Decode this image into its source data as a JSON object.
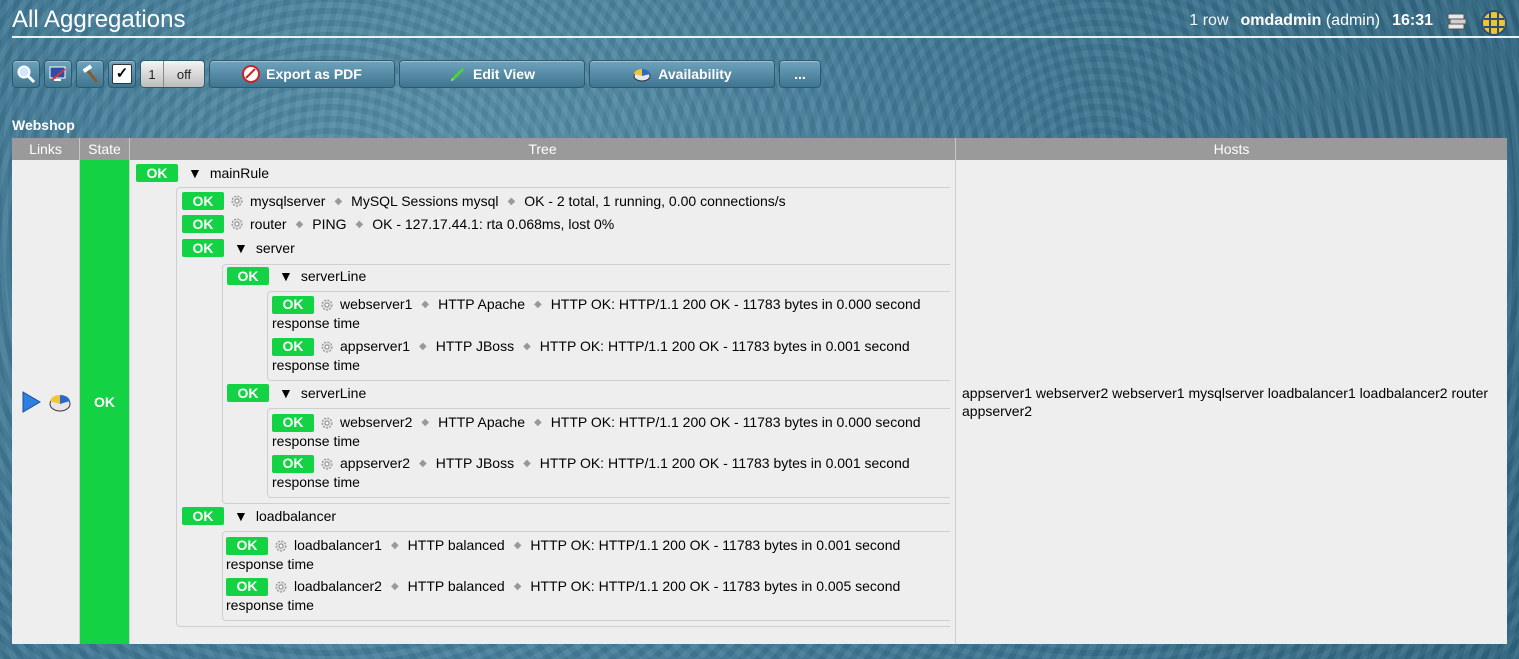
{
  "header": {
    "title": "All Aggregations",
    "rows": "1 row",
    "user": "omdadmin",
    "role": "(admin)",
    "time": "16:31",
    "icons": [
      "books-icon",
      "omd-logo-icon"
    ]
  },
  "toolbar": {
    "count": "1",
    "off": "off",
    "export_pdf": "Export as PDF",
    "edit_view": "Edit View",
    "availability": "Availability",
    "more": "..."
  },
  "section": {
    "title": "Webshop"
  },
  "table": {
    "headers": {
      "links": "Links",
      "state": "State",
      "tree": "Tree",
      "hosts": "Hosts"
    },
    "state": "OK",
    "hosts": "appserver1 webserver2 webserver1 mysqlserver loadbalancer1 loadbalancer2 router appserver2"
  },
  "tree": {
    "ok": "OK",
    "main_rule": "mainRule",
    "mysql": {
      "host": "mysqlserver",
      "service": "MySQL Sessions mysql",
      "output": "OK - 2 total, 1 running, 0.00 connections/s"
    },
    "router": {
      "host": "router",
      "service": "PING",
      "output": "OK - 127.17.44.1: rta 0.068ms, lost 0%"
    },
    "server": "server",
    "server_line_1": "serverLine",
    "web1": {
      "host": "webserver1",
      "service": "HTTP Apache",
      "output": "HTTP OK: HTTP/1.1 200 OK - 11783 bytes in 0.000 second",
      "output2": "response time"
    },
    "app1": {
      "host": "appserver1",
      "service": "HTTP JBoss",
      "output": "HTTP OK: HTTP/1.1 200 OK - 11783 bytes in 0.001 second",
      "output2": "response time"
    },
    "server_line_2": "serverLine",
    "web2": {
      "host": "webserver2",
      "service": "HTTP Apache",
      "output": "HTTP OK: HTTP/1.1 200 OK - 11783 bytes in 0.000 second",
      "output2": "response time"
    },
    "app2": {
      "host": "appserver2",
      "service": "HTTP JBoss",
      "output": "HTTP OK: HTTP/1.1 200 OK - 11783 bytes in 0.001 second",
      "output2": "response time"
    },
    "loadbalancer": "loadbalancer",
    "lb1": {
      "host": "loadbalancer1",
      "service": "HTTP balanced",
      "output": "HTTP OK: HTTP/1.1 200 OK - 11783 bytes in 0.001 second",
      "output2": "response time"
    },
    "lb2": {
      "host": "loadbalancer2",
      "service": "HTTP balanced",
      "output": "HTTP OK: HTTP/1.1 200 OK - 11783 bytes in 0.005 second",
      "output2": "response time"
    }
  },
  "colors": {
    "ok_green": "#13d244",
    "header_gray": "#9a9a9a",
    "row_bg": "#eeeeee"
  }
}
